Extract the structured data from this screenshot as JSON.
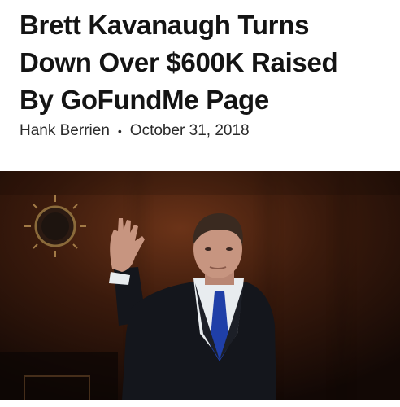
{
  "article": {
    "headline_lines": [
      "Brett Kavanaugh Turns",
      "Down Over $600K Raised",
      "By GoFundMe Page"
    ],
    "author": "Hank Berrien",
    "separator": "•",
    "date": "October 31, 2018"
  },
  "photo": {
    "subject": "man in dark suit raising right hand",
    "colors": {
      "background": "#2a140b",
      "panel_glow": "#6b3318",
      "suit": "#14161c",
      "tie": "#1f3fa8",
      "shirt": "#e8ecef",
      "skin": "#c79580"
    }
  }
}
